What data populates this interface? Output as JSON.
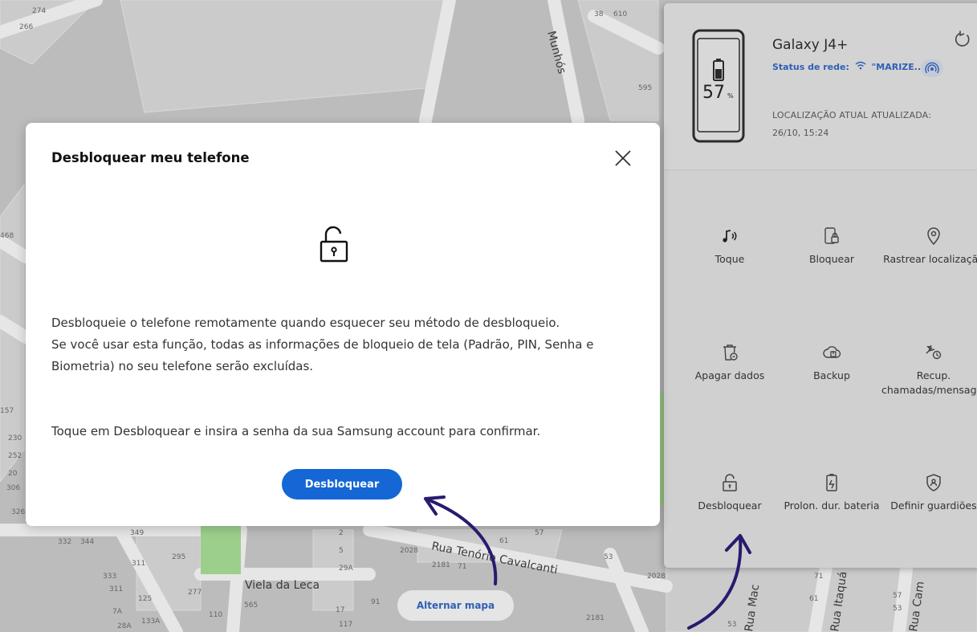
{
  "map": {
    "street_labels": [
      "Rua Tenório Cavalcanti",
      "Viela da Leca",
      "Munhós",
      "Rua Itaquá",
      "Rua Mac",
      "Rua Cam"
    ],
    "numbers": [
      "274",
      "266",
      "38",
      "610",
      "595",
      "468",
      "157",
      "230",
      "252",
      "20",
      "306",
      "326",
      "332",
      "344",
      "349",
      "333",
      "311",
      "7A",
      "28A",
      "133A",
      "125",
      "311",
      "295",
      "277",
      "110",
      "565",
      "2",
      "5",
      "29A",
      "17",
      "117",
      "91",
      "2028",
      "2181",
      "71",
      "61",
      "57",
      "53"
    ]
  },
  "device": {
    "name": "Galaxy J4+",
    "network_label": "Status de rede:",
    "network_value": "\"MARIZE...",
    "battery": "57",
    "battery_unit": "%",
    "location_label": "LOCALIZAÇÃO ATUAL ATUALIZADA:",
    "location_time": "26/10, 15:24",
    "actions": [
      {
        "label": "Toque",
        "icon": "sound-icon"
      },
      {
        "label": "Bloquear",
        "icon": "lock-phone-icon"
      },
      {
        "label": "Rastrear localização",
        "icon": "location-pin-icon"
      },
      {
        "label": "Apagar dados",
        "icon": "trash-icon"
      },
      {
        "label": "Backup",
        "icon": "cloud-backup-icon"
      },
      {
        "label": "Recup. chamadas/mensagens",
        "icon": "call-retrieve-icon"
      },
      {
        "label": "Desbloquear",
        "icon": "unlock-icon"
      },
      {
        "label": "Prolon. dur. bateria",
        "icon": "battery-icon"
      },
      {
        "label": "Definir guardiões",
        "icon": "shield-icon"
      }
    ]
  },
  "modal": {
    "title": "Desbloquear meu telefone",
    "body_line1": "Desbloqueie o telefone remotamente quando esquecer seu método de desbloqueio.",
    "body_line2": "Se você usar esta função, todas as informações de bloqueio de tela (Padrão, PIN, Senha e Biometria) no seu telefone serão excluídas.",
    "body_line3": "Toque em Desbloquear e insira a senha da sua Samsung account para confirmar.",
    "button_label": "Desbloquear",
    "accent_color": "#1467d4"
  },
  "map_controls": {
    "toggle_label": "Alternar mapa"
  },
  "annotations": {
    "arrow_color": "#2a1a6e"
  }
}
